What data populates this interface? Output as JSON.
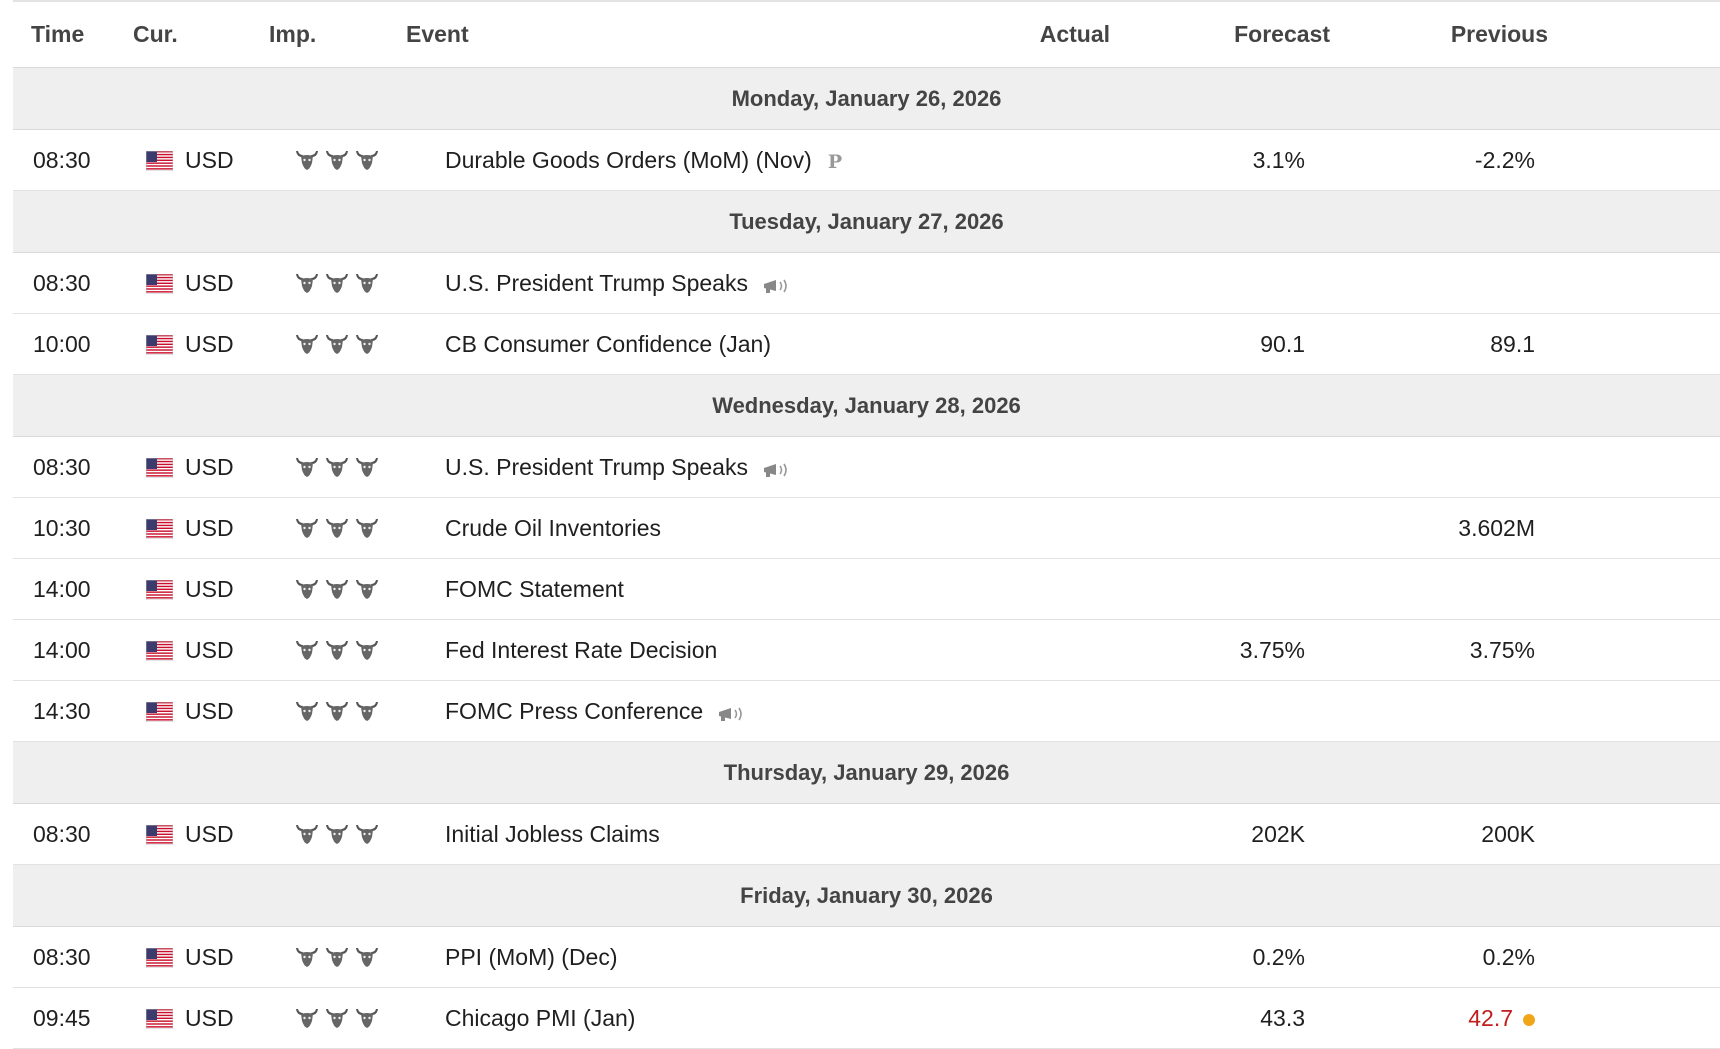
{
  "columns": {
    "time": "Time",
    "currency": "Cur.",
    "importance": "Imp.",
    "event": "Event",
    "actual": "Actual",
    "forecast": "Forecast",
    "previous": "Previous"
  },
  "days": [
    {
      "label": "Monday, January 26, 2026",
      "events": [
        {
          "time": "08:30",
          "currency": "USD",
          "importance": 3,
          "event": "Durable Goods Orders (MoM) (Nov)",
          "icon": "preliminary-icon",
          "icon_text": "P",
          "actual": "",
          "forecast": "3.1%",
          "previous": "-2.2%"
        }
      ]
    },
    {
      "label": "Tuesday, January 27, 2026",
      "events": [
        {
          "time": "08:30",
          "currency": "USD",
          "importance": 3,
          "event": "U.S. President Trump Speaks",
          "icon": "speech-icon",
          "actual": "",
          "forecast": "",
          "previous": ""
        },
        {
          "time": "10:00",
          "currency": "USD",
          "importance": 3,
          "event": "CB Consumer Confidence (Jan)",
          "actual": "",
          "forecast": "90.1",
          "previous": "89.1"
        }
      ]
    },
    {
      "label": "Wednesday, January 28, 2026",
      "events": [
        {
          "time": "08:30",
          "currency": "USD",
          "importance": 3,
          "event": "U.S. President Trump Speaks",
          "icon": "speech-icon",
          "actual": "",
          "forecast": "",
          "previous": ""
        },
        {
          "time": "10:30",
          "currency": "USD",
          "importance": 3,
          "event": "Crude Oil Inventories",
          "actual": "",
          "forecast": "",
          "previous": "3.602M"
        },
        {
          "time": "14:00",
          "currency": "USD",
          "importance": 3,
          "event": "FOMC Statement",
          "actual": "",
          "forecast": "",
          "previous": ""
        },
        {
          "time": "14:00",
          "currency": "USD",
          "importance": 3,
          "event": "Fed Interest Rate Decision",
          "actual": "",
          "forecast": "3.75%",
          "previous": "3.75%"
        },
        {
          "time": "14:30",
          "currency": "USD",
          "importance": 3,
          "event": "FOMC Press Conference",
          "icon": "speech-icon",
          "actual": "",
          "forecast": "",
          "previous": ""
        }
      ]
    },
    {
      "label": "Thursday, January 29, 2026",
      "events": [
        {
          "time": "08:30",
          "currency": "USD",
          "importance": 3,
          "event": "Initial Jobless Claims",
          "actual": "",
          "forecast": "202K",
          "previous": "200K"
        }
      ]
    },
    {
      "label": "Friday, January 30, 2026",
      "events": [
        {
          "time": "08:30",
          "currency": "USD",
          "importance": 3,
          "event": "PPI (MoM) (Dec)",
          "actual": "",
          "forecast": "0.2%",
          "previous": "0.2%"
        },
        {
          "time": "09:45",
          "currency": "USD",
          "importance": 3,
          "event": "Chicago PMI (Jan)",
          "actual": "",
          "forecast": "43.3",
          "previous": "42.7",
          "previous_color": "#c21d1d",
          "previous_marker": "revised-dot-icon"
        }
      ]
    }
  ],
  "colors": {
    "day_header_bg": "#efefef",
    "negative": "#c21d1d",
    "revised_dot": "#f0a619"
  }
}
